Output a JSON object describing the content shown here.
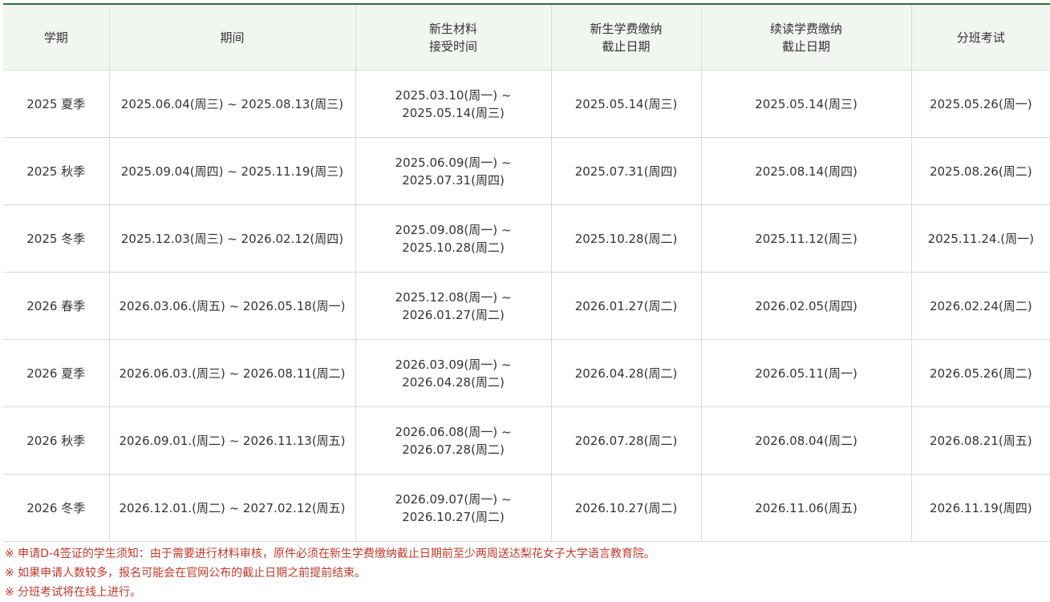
{
  "colors": {
    "header_bg": "#f2f6f1",
    "top_border": "#2e6b3a",
    "note_text": "#c0392b"
  },
  "headers": [
    [
      "学期"
    ],
    [
      "期间"
    ],
    [
      "新生材料",
      "接受时间"
    ],
    [
      "新生学费缴纳",
      "截止日期"
    ],
    [
      "续读学费缴纳",
      "截止日期"
    ],
    [
      "分班考试"
    ]
  ],
  "rows": [
    {
      "term": "2025 夏季",
      "period": "2025.06.04(周三) ~ 2025.08.13(周三)",
      "materials": [
        "2025.03.10(周一) ~",
        "2025.05.14(周三)"
      ],
      "new_fee": "2025.05.14(周三)",
      "continuing_fee": "2025.05.14(周三)",
      "placement": "2025.05.26(周一)"
    },
    {
      "term": "2025 秋季",
      "period": "2025.09.04(周四) ~ 2025.11.19(周三)",
      "materials": [
        "2025.06.09(周一) ~",
        "2025.07.31(周四)"
      ],
      "new_fee": "2025.07.31(周四)",
      "continuing_fee": "2025.08.14(周四)",
      "placement": "2025.08.26(周二)"
    },
    {
      "term": "2025 冬季",
      "period": "2025.12.03(周三) ~ 2026.02.12(周四)",
      "materials": [
        "2025.09.08(周一) ~",
        "2025.10.28(周二)"
      ],
      "new_fee": "2025.10.28(周二)",
      "continuing_fee": "2025.11.12(周三)",
      "placement": "2025.11.24.(周一)"
    },
    {
      "term": "2026 春季",
      "period": "2026.03.06.(周五) ~ 2026.05.18(周一)",
      "materials": [
        "2025.12.08(周一) ~",
        "2026.01.27(周二)"
      ],
      "new_fee": "2026.01.27(周二)",
      "continuing_fee": "2026.02.05(周四)",
      "placement": "2026.02.24(周二)"
    },
    {
      "term": "2026 夏季",
      "period": "2026.06.03.(周三) ~ 2026.08.11(周二)",
      "materials": [
        "2026.03.09(周一) ~",
        "2026.04.28(周二)"
      ],
      "new_fee": "2026.04.28(周二)",
      "continuing_fee": "2026.05.11(周一)",
      "placement": "2026.05.26(周二)"
    },
    {
      "term": "2026 秋季",
      "period": "2026.09.01.(周二) ~ 2026.11.13(周五)",
      "materials": [
        "2026.06.08(周一) ~",
        "2026.07.28(周二)"
      ],
      "new_fee": "2026.07.28(周二)",
      "continuing_fee": "2026.08.04(周二)",
      "placement": "2026.08.21(周五)"
    },
    {
      "term": "2026 冬季",
      "period": "2026.12.01.(周二) ~ 2027.02.12(周五)",
      "materials": [
        "2026.09.07(周一) ~",
        "2026.10.27(周二)"
      ],
      "new_fee": "2026.10.27(周二)",
      "continuing_fee": "2026.11.06(周五)",
      "placement": "2026.11.19(周四)"
    }
  ],
  "notes": [
    "※ 申请D-4签证的学生须知：由于需要进行材料审核，原件必须在新生学费缴纳截止日期前至少两周送达梨花女子大学语言教育院。",
    "※ 如果申请人数较多，报名可能会在官网公布的截止日期之前提前结束。",
    "※ 分班考试将在线上进行。"
  ]
}
